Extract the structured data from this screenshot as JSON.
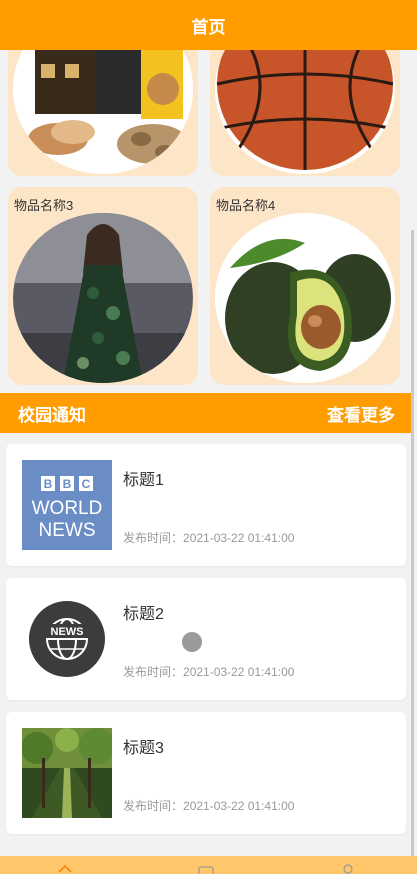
{
  "header": {
    "title": "首页"
  },
  "products": [
    {
      "name": "",
      "image": "snacks-photo"
    },
    {
      "name": "",
      "image": "basketball-photo"
    },
    {
      "name": "物品名称3",
      "image": "dress-photo"
    },
    {
      "name": "物品名称4",
      "image": "avocado-photo"
    }
  ],
  "notice": {
    "title": "校园通知",
    "more_label": "查看更多"
  },
  "news": [
    {
      "title": "标题1",
      "time_prefix": "发布时间：",
      "time": "2021-03-22 01:41:00",
      "image": "bbc-world-news-logo",
      "thumb_text": {
        "bbc": [
          "B",
          "B",
          "C"
        ],
        "line1": "WORLD",
        "line2": "NEWS"
      }
    },
    {
      "title": "标题2",
      "time_prefix": "发布时间：",
      "time": "2021-03-22 01:41:00",
      "image": "news-globe-icon",
      "thumb_text": {
        "badge": "NEWS"
      }
    },
    {
      "title": "标题3",
      "time_prefix": "发布时间：",
      "time": "2021-03-22 01:41:00",
      "image": "park-path-photo"
    }
  ],
  "colors": {
    "accent": "#ff9c00",
    "card_bg": "#fde6c8",
    "tabbar": "#ffc66a"
  },
  "tabbar": {
    "icons": [
      "home-icon",
      "message-icon",
      "user-icon"
    ]
  }
}
